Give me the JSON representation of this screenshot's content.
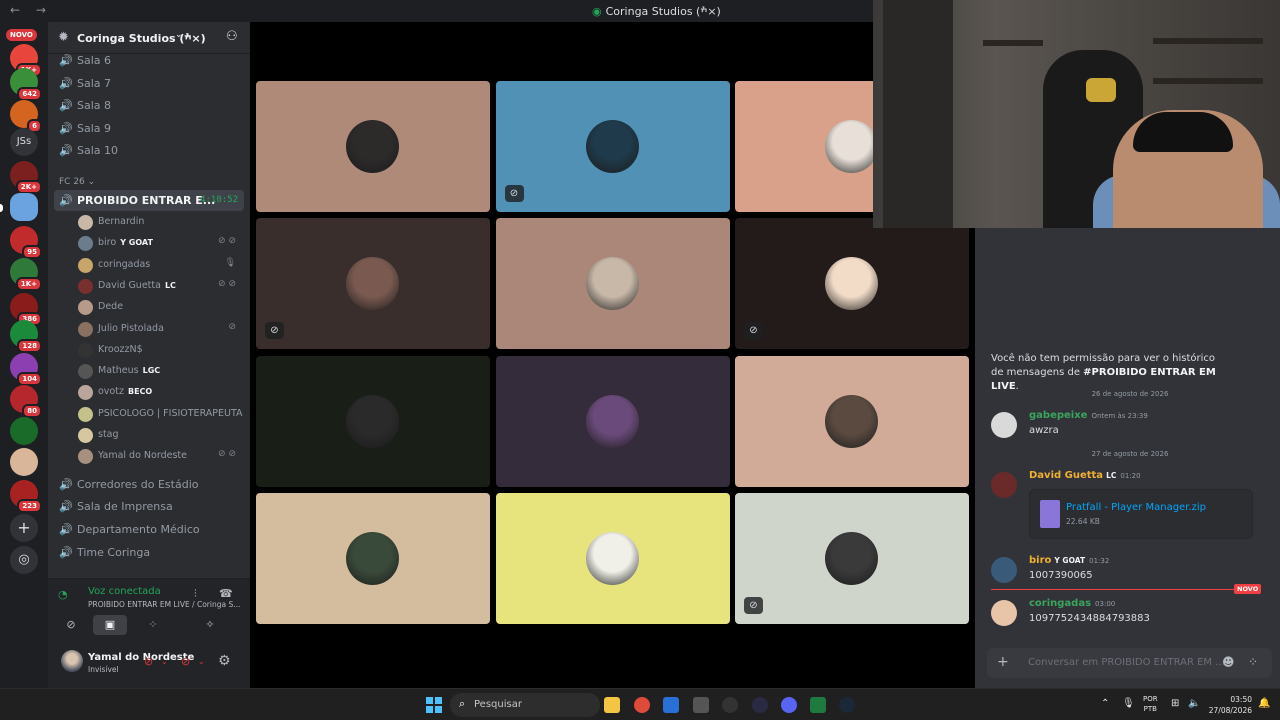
{
  "titlebar": {
    "back": "←",
    "forward": "→",
    "title": "Coringa Studios (ׯ×)"
  },
  "guild_rail": {
    "novo_badge": "NOVO",
    "badges": [
      "1K+",
      "642",
      "6",
      "2K+",
      "95",
      "1K+",
      "386",
      "128",
      "104",
      "80",
      "223"
    ],
    "text_guild": "JSs"
  },
  "server": {
    "name": "Coringa Studios (ׯ×)"
  },
  "channels": {
    "top": [
      "Sala 6",
      "Sala 7",
      "Sala 8",
      "Sala 9",
      "Sala 10"
    ],
    "category": "FC 26",
    "active": {
      "name": "PROIBIDO ENTRAR E...",
      "timer": "4:10:52"
    },
    "voice_users": [
      {
        "name": "Bernardin",
        "tag": "",
        "status": ""
      },
      {
        "name": "biro",
        "tag": "Y GOAT",
        "status": "⊘ ⊘"
      },
      {
        "name": "coringadas",
        "tag": "",
        "status": "🎙"
      },
      {
        "name": "David Guetta",
        "tag": "LC",
        "status": "⊘ ⊘"
      },
      {
        "name": "Dede",
        "tag": "",
        "status": ""
      },
      {
        "name": "Julio Pistolada",
        "tag": "",
        "status": "⊘"
      },
      {
        "name": "KroozzN$",
        "tag": "",
        "status": ""
      },
      {
        "name": "Matheus",
        "tag": "LGC",
        "status": ""
      },
      {
        "name": "ovotz",
        "tag": "BECO",
        "status": ""
      },
      {
        "name": "PSICOLOGO | FISIOTERAPEUTA",
        "tag": "",
        "status": ""
      },
      {
        "name": "stag",
        "tag": "",
        "status": ""
      },
      {
        "name": "Yamal do Nordeste",
        "tag": "",
        "status": "⊘ ⊘"
      }
    ],
    "bottom": [
      "Corredores do Estádio",
      "Sala de Imprensa",
      "Departamento Médico",
      "Time Coringa"
    ]
  },
  "voice_panel": {
    "status": "Voz conectada",
    "location": "PROIBIDO ENTRAR EM LIVE / Coringa S..."
  },
  "user_panel": {
    "name": "Yamal do Nordeste",
    "status": "Invisível"
  },
  "tiles": [
    {
      "bg": "#b08a78",
      "deaf": false
    },
    {
      "bg": "#5191b6",
      "deaf": true
    },
    {
      "bg": "#d9a08a",
      "deaf": false
    },
    {
      "bg": "#3a2e2c",
      "deaf": true
    },
    {
      "bg": "#ab8779",
      "deaf": false
    },
    {
      "bg": "#231a1a",
      "deaf": true
    },
    {
      "bg": "#191e17",
      "deaf": false
    },
    {
      "bg": "#342b3b",
      "deaf": false
    },
    {
      "bg": "#d2aa98",
      "deaf": false
    },
    {
      "bg": "#d4bd9e",
      "deaf": false
    },
    {
      "bg": "#e7e47d",
      "deaf": false
    },
    {
      "bg": "#d0d5cb",
      "deaf": true
    }
  ],
  "chat": {
    "permission_1": "Você não tem permissão para ver o histórico de mensagens de ",
    "permission_channel": "#PROIBIDO ENTRAR EM LIVE",
    "permission_end": ".",
    "date_1": "26 de agosto de 2026",
    "date_2": "27 de agosto de 2026",
    "messages": [
      {
        "author": "gabepeixe",
        "tag": "",
        "time": "Ontem às 23:39",
        "text": "awzra",
        "color": "#3ba55c"
      },
      {
        "author": "David Guetta",
        "tag": "LC",
        "time": "01:20",
        "text": "",
        "color": "#f0b132"
      },
      {
        "author": "biro",
        "tag": "Y GOAT",
        "time": "01:32",
        "text": "1007390065",
        "color": "#f0b132"
      },
      {
        "author": "coringadas",
        "tag": "",
        "time": "03:00",
        "text": "1097752434884793883",
        "color": "#3ba55c"
      }
    ],
    "attachment": {
      "name": "Pratfall - Player Manager.zip",
      "size": "22.64 KB"
    },
    "new_badge": "NOVO",
    "placeholder": "Conversar em PROIBIDO ENTRAR EM ..."
  },
  "taskbar": {
    "search": "Pesquisar",
    "lang_1": "POR",
    "lang_2": "PTB",
    "time": "03:50",
    "date": "27/08/2026"
  }
}
